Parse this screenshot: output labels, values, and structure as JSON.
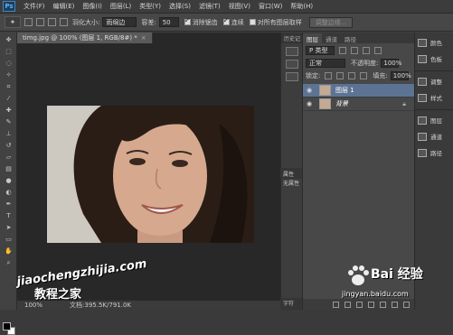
{
  "app": {
    "logo": "Ps"
  },
  "menu": [
    "文件(F)",
    "编辑(E)",
    "图像(I)",
    "图层(L)",
    "类型(Y)",
    "选择(S)",
    "滤镜(T)",
    "视图(V)",
    "窗口(W)",
    "帮助(H)"
  ],
  "options": {
    "feather_label": "羽化大小:",
    "style_value": "雨绵边",
    "tolerance_label": "容差:",
    "tolerance_value": "50",
    "antialias_label": "消除锯齿",
    "contiguous_label": "连续",
    "sample_all_label": "对所有图层取样",
    "refine_button": "调整边缘..."
  },
  "document": {
    "tab_title": "timg.jpg @ 100% (图层 1, RGB/8#) *",
    "zoom": "100%",
    "doc_info": "文档:395.5K/791.0K"
  },
  "collapsed_panels": {
    "history_tab": "历史记",
    "properties_tab": "属性",
    "properties_body": "无属性",
    "text_tab": "字符"
  },
  "layers_panel": {
    "tabs": [
      "图层",
      "通道",
      "路径"
    ],
    "filter_label": "P 类型",
    "blend_mode": "正常",
    "opacity_label": "不透明度:",
    "opacity_value": "100%",
    "lock_label": "锁定:",
    "fill_label": "填充:",
    "fill_value": "100%",
    "layers": [
      {
        "name": "图层 1",
        "selected": true
      },
      {
        "name": "背景",
        "selected": false
      }
    ]
  },
  "dock": {
    "items": [
      "颜色",
      "色板",
      "调整",
      "样式",
      "图层",
      "通道",
      "路径"
    ]
  },
  "watermarks": {
    "left_url": "jiaochengzhijia.com",
    "left_cn": "教程之家",
    "baidu": "Bai 经验",
    "baidu_url": "jingyan.baidu.com"
  }
}
